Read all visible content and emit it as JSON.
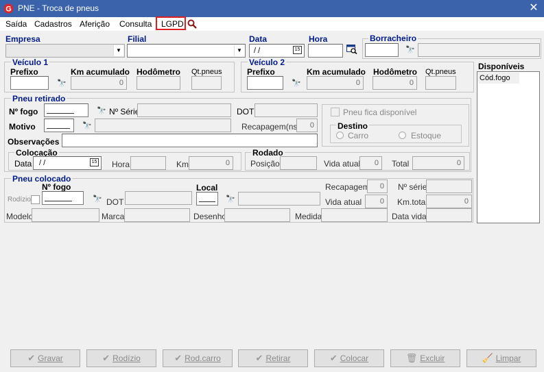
{
  "window": {
    "title": "PNE - Troca de pneus"
  },
  "menu": [
    "Saída",
    "Cadastros",
    "Aferição",
    "Consulta",
    "LGPD"
  ],
  "top": {
    "empresa_label": "Empresa",
    "filial_label": "Filial",
    "data_label": "Data",
    "data_value": " / /",
    "hora_label": "Hora",
    "borracheiro_label": "Borracheiro"
  },
  "veiculo1": {
    "title": "Veículo 1",
    "prefixo": "Prefixo",
    "km_acumulado": "Km acumulado",
    "km_value": "0",
    "hodometro": "Hodômetro",
    "hodometro_value": "",
    "qt_pneus": "Qt.pneus"
  },
  "veiculo2": {
    "title": "Veículo 2",
    "prefixo": "Prefixo",
    "km_acumulado": "Km acumulado",
    "km_value": "0",
    "hodometro": "Hodômetro",
    "hodometro_value": "0",
    "qt_pneus": "Qt.pneus"
  },
  "disponiveis": {
    "title": "Disponíveis",
    "column": "Cód.fogo"
  },
  "retirado": {
    "title": "Pneu retirado",
    "n_fogo": "Nº fogo",
    "n_serie": "Nº Série",
    "dot": "DOT",
    "motivo": "Motivo",
    "recapagem": "Recapagem(ns)",
    "recapagem_value": "0",
    "observacoes": "Observações",
    "fica_disponivel": "Pneu fica disponível",
    "destino": "Destino",
    "carro": "Carro",
    "estoque": "Estoque",
    "colocacao": "Colocação",
    "data": "Data",
    "data_value": " / /",
    "hora": "Hora",
    "km": "Km",
    "km_value": "0",
    "rodado": "Rodado",
    "posicao": "Posição",
    "vida_atual": "Vida atual",
    "vida_atual_value": "0",
    "total": "Total",
    "total_value": "0"
  },
  "colocado": {
    "title": "Pneu colocado",
    "n_fogo": "Nº fogo",
    "rodizio": "Rodízio",
    "dot": "DOT",
    "local": "Local",
    "recapagem": "Recapagem",
    "recapagem_value": "0",
    "n_serie": "Nº série",
    "vida_atual": "Vida atual",
    "vida_atual_value": "0",
    "km_total": "Km.total",
    "km_total_value": "0",
    "modelo": "Modelo",
    "marca": "Marca",
    "desenho": "Desenho",
    "medida": "Medida",
    "data_vida": "Data vida"
  },
  "buttons": {
    "gravar": "Gravar",
    "rodizio": "Rodízio",
    "rod_carro": "Rod.carro",
    "retirar": "Retirar",
    "colocar": "Colocar",
    "excluir": "Excluir",
    "limpar": "Limpar"
  },
  "colors": {
    "titlebar": "#3a63ac",
    "label_blue": "#001a8c",
    "highlight": "#e02020"
  }
}
